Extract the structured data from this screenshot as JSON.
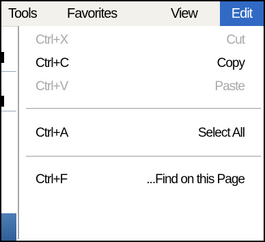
{
  "menubar": {
    "items": [
      {
        "label": "Tools"
      },
      {
        "label": "Favorites"
      },
      {
        "label": "View"
      },
      {
        "label": "Edit"
      }
    ],
    "active": "Edit"
  },
  "dropdown": {
    "items": [
      {
        "shortcut": "Ctrl+X",
        "label": "Cut",
        "enabled": false
      },
      {
        "shortcut": "Ctrl+C",
        "label": "Copy",
        "enabled": true
      },
      {
        "shortcut": "Ctrl+V",
        "label": "Paste",
        "enabled": false
      },
      {
        "shortcut": "Ctrl+A",
        "label": "Select All",
        "enabled": true
      },
      {
        "shortcut": "Ctrl+F",
        "label": "...Find on this Page",
        "enabled": true
      }
    ]
  },
  "colors": {
    "highlight": "#316ac5",
    "disabled_text": "#a9a9a9",
    "menubar_bg": "#f2f1ec"
  }
}
